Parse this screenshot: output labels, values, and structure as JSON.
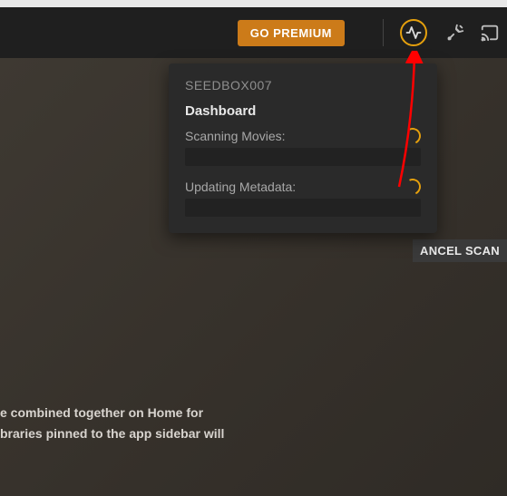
{
  "header": {
    "premium_label": "GO PREMIUM"
  },
  "popover": {
    "server": "SEEDBOX007",
    "section": "Dashboard",
    "tasks": [
      {
        "label": "Scanning Movies:"
      },
      {
        "label": "Updating Metadata:"
      }
    ]
  },
  "cancel_label": "ANCEL SCAN",
  "bottom_text": {
    "line1": "e combined together on Home for",
    "line2": "braries pinned to the app sidebar will"
  }
}
